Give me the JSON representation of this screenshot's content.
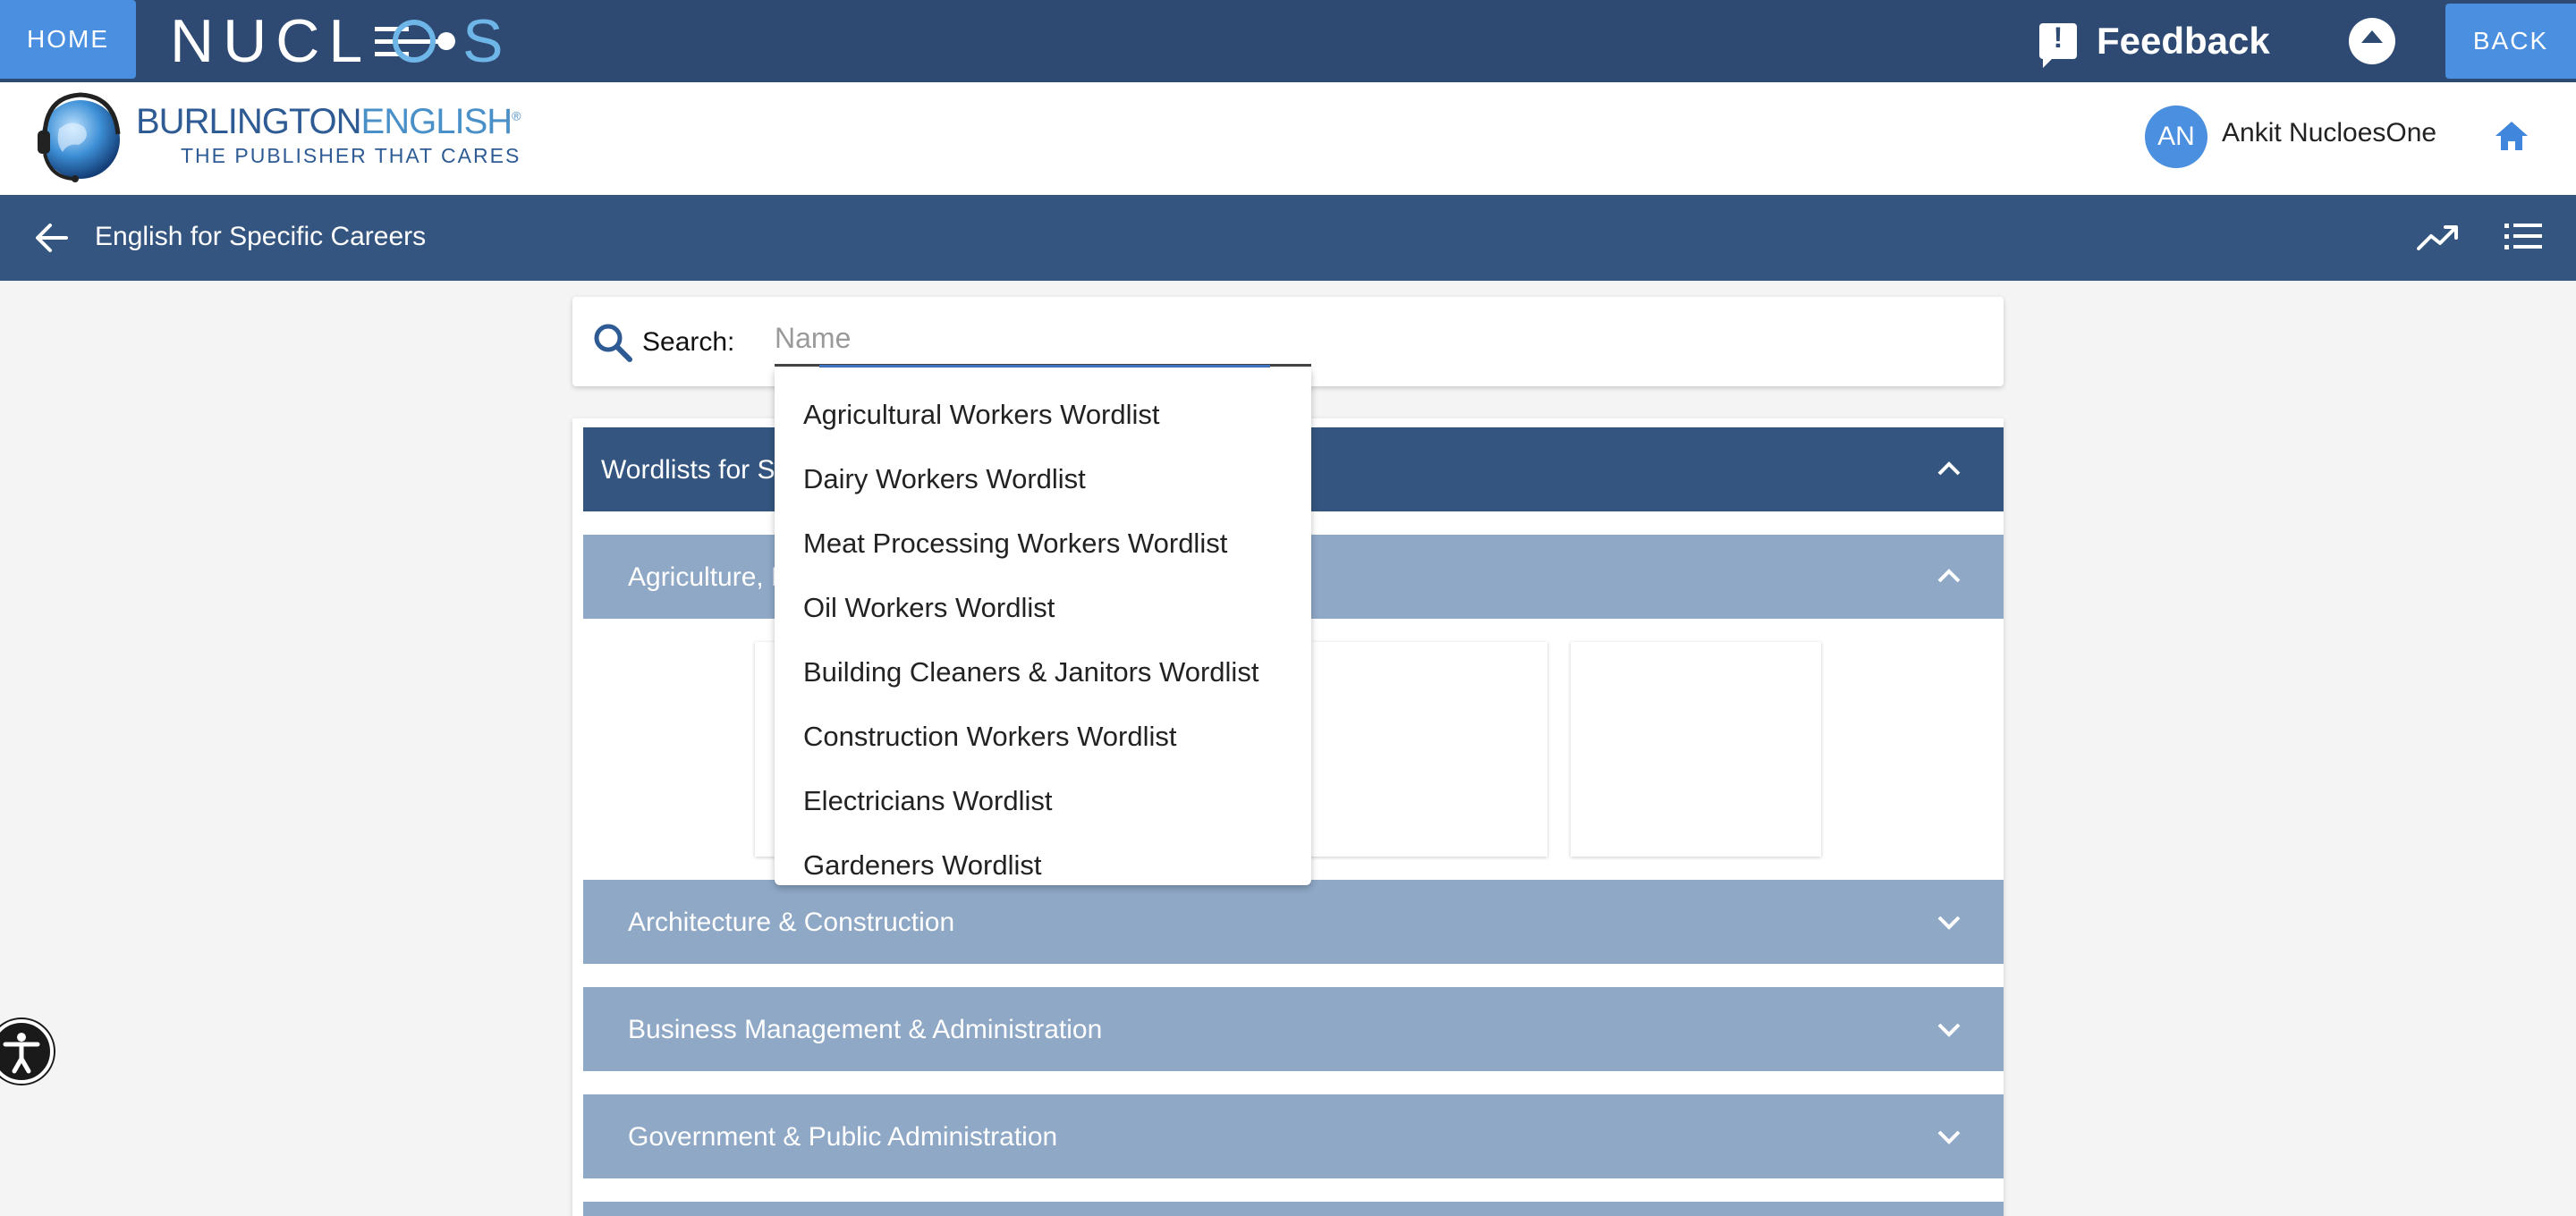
{
  "topbar": {
    "home_label": "HOME",
    "logo_left": "NUCL",
    "logo_right": "S",
    "feedback_label": "Feedback",
    "back_label": "BACK"
  },
  "brand": {
    "name_part1": "BURLINGTON",
    "name_part2": "ENGLISH",
    "registered": "®",
    "tagline": "THE PUBLISHER THAT CARES"
  },
  "user": {
    "initials": "AN",
    "name": "Ankit NucloesOne"
  },
  "titlebar": {
    "title": "English for Specific Careers"
  },
  "search": {
    "label": "Search:",
    "placeholder": "Name",
    "value": ""
  },
  "dropdown": {
    "items": [
      "Agricultural Workers Wordlist",
      "Dairy Workers Wordlist",
      "Meat Processing Workers Wordlist",
      "Oil Workers Wordlist",
      "Building Cleaners & Janitors Wordlist",
      "Construction Workers Wordlist",
      "Electricians Wordlist",
      "Gardeners Wordlist"
    ]
  },
  "sections": {
    "main_header": "Wordlists for S",
    "agriculture": "Agriculture, F",
    "architecture": "Architecture & Construction",
    "business": "Business Management & Administration",
    "government": "Government & Public Administration"
  },
  "colors": {
    "topbar": "#2e4a73",
    "button_blue": "#4a8fe0",
    "section_dark": "#34557f",
    "section_light": "#8ea8c6"
  }
}
